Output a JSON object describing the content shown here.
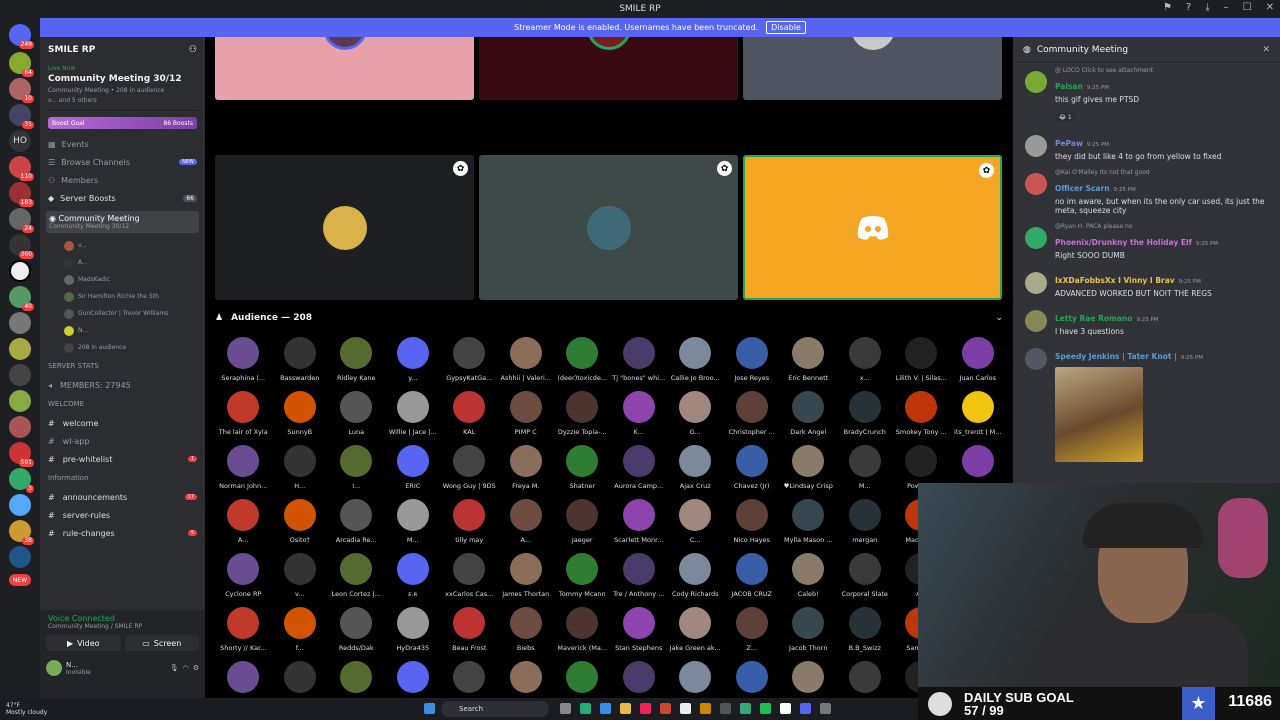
{
  "window": {
    "title": "SMILE RP"
  },
  "banner": {
    "text": "Streamer Mode is enabled. Usernames have been truncated.",
    "button": "Disable"
  },
  "rail": {
    "badges": [
      "249",
      "64",
      "10",
      "31",
      "110",
      "183",
      "24",
      "360",
      "40",
      "591",
      "3",
      "38"
    ],
    "home_label": "HO",
    "new_label": "NEW"
  },
  "sidebar": {
    "server_name": "SMILE RP",
    "event": {
      "status": "Live Now",
      "title": "Community Meeting 30/12",
      "meta": "Community Meeting • 208 in audience",
      "others": "v... and 5 others"
    },
    "boost": {
      "label": "Boost Goal",
      "count": "86 Boosts"
    },
    "nav": [
      {
        "label": "Events"
      },
      {
        "label": "Browse Channels",
        "tag": "NEW"
      },
      {
        "label": "Members"
      },
      {
        "label": "Server Boosts",
        "num": "66"
      }
    ],
    "voice_channel": {
      "name": "Community Meeting",
      "sub": "Community Meeting 30/12"
    },
    "members": [
      "v...",
      "A...",
      "MadsKadic",
      "Sir Hamilton Richie the 5th",
      "GunCollector | Trevor Williams",
      "N..."
    ],
    "audience_count": "208 in audience",
    "cat_stats": "SERVER STATS",
    "members_count": "MEMBERS: 27945",
    "cat_welcome": "WELCOME",
    "channels_a": [
      {
        "name": "welcome"
      },
      {
        "name": "wl-app"
      },
      {
        "name": "pre-whitelist",
        "badge": "1"
      }
    ],
    "cat_info": "Information",
    "channels_b": [
      {
        "name": "announcements",
        "badge": "17"
      },
      {
        "name": "server-rules"
      },
      {
        "name": "rule-changes",
        "badge": "5"
      }
    ],
    "voice": {
      "status": "Voice Connected",
      "sub": "Community Meeting / SMILE RP",
      "video": "Video",
      "screen": "Screen"
    },
    "user": {
      "name": "N...",
      "status": "Invisible"
    }
  },
  "stage": {
    "audience_label": "Audience — 208",
    "audience": [
      "Seraphina (...",
      "Basswarden",
      "Ridley Kane",
      "y...",
      "GypsyKatGa...",
      "Ashhii | Valeri...",
      "(deer)toxicde...",
      "Tj \"bones\" whi...",
      "Callie Jo Broo...",
      "Jose Reyes",
      "Eric Bennett",
      "x...",
      "Lilith V. | Silas...",
      "Juan Carlos",
      "The lair of Xyla",
      "SunnyB",
      "Luna",
      "Willie | Jace |...",
      "KAL",
      "PIMP C",
      "Dyzzie Topia-...",
      "K...",
      "G...",
      "Christopher ...",
      "Dark Angel",
      "BradyCrunch",
      "Smokey Tony ...",
      "its_trentt | M...",
      "Norman John...",
      "H...",
      "I...",
      "ERIC",
      "Wong Guy | 9DS",
      "Freya M.",
      "Shatner",
      "Aurora Camp...",
      "Ajax Cruz",
      "Chavez (Jr)",
      "♥Lindsay Crisp",
      "M...",
      "Powwo...",
      "",
      "A...",
      "Osito†",
      "Arcadia Re...",
      "M...",
      "tilly may",
      "A...",
      "Jaeger",
      "Scarlett Monr...",
      "C...",
      "Nico Hayes",
      "Mylla Mason ...",
      "mergan",
      "Maddox...",
      "",
      "Cyclone RP",
      "v...",
      "Leon Cortez |...",
      "ᴇ.ʀ",
      "xxCarlos Cas...",
      "James Thortan",
      "Tommy Mcann",
      "Tre / Anthony ...",
      "Cody Richards",
      "JACOB CRUZ",
      "Caleb!",
      "Corporal Slate",
      "A...",
      "",
      "Shorty // Kar...",
      "f...",
      "Redds/Dak",
      "HyDra435",
      "Beau Frost",
      "Biebs",
      "Maverick (Ma...",
      "Stan Stephens",
      "Jake Green ak...",
      "Z...",
      "Jacob Thorn",
      "B.B_Swizz",
      "Sammy...",
      "",
      "",
      "",
      "",
      "",
      "",
      "",
      "",
      "",
      "",
      "",
      "",
      "",
      "",
      ""
    ]
  },
  "chat": {
    "title": "Community Meeting",
    "messages": [
      {
        "reply": "@ LOCO Click to see attachment",
        "name": "Paisan",
        "time": "9:25 PM",
        "text": "this gif gives me PTSD",
        "color": "#23a55a",
        "react": "😂 1"
      },
      {
        "reply": "",
        "name": "PePaw",
        "time": "9:25 PM",
        "text": "they did but like 4 to go from yellow to fixed",
        "color": "#7289da"
      },
      {
        "reply": "@Kai O'Malley Its not that good",
        "name": "Officer Scarn",
        "time": "9:25 PM",
        "text": "no im aware, but when its the only car used, its just the meta, squeeze city",
        "color": "#5b9bd5"
      },
      {
        "reply": "@Ryan H. PACA please no",
        "name": "Phoenix/Drunkny the Holiday Elf",
        "time": "9:25 PM",
        "text": "Right SOOO DUMB",
        "color": "#c86fd6"
      },
      {
        "reply": "",
        "name": "IxXDaFobbsXx I Vinny I Brav",
        "time": "9:25 PM",
        "text": "ADVANCED WORKED BUT NOIT THE REGS",
        "color": "#e8c04a"
      },
      {
        "reply": "",
        "name": "Letty Rae Romano",
        "time": "9:25 PM",
        "text": "I have 3 questions",
        "color": "#23a55a"
      },
      {
        "reply": "",
        "name": "Speedy Jenkins | Tater Knot |",
        "time": "9:25 PM",
        "text": "",
        "color": "#5b9bd5"
      }
    ]
  },
  "overlay": {
    "goal_title": "DAILY SUB GOAL",
    "goal_progress": "57 / 99",
    "count": "11686"
  },
  "taskbar": {
    "temp": "47°F",
    "weather": "Mostly cloudy",
    "search": "Search"
  }
}
